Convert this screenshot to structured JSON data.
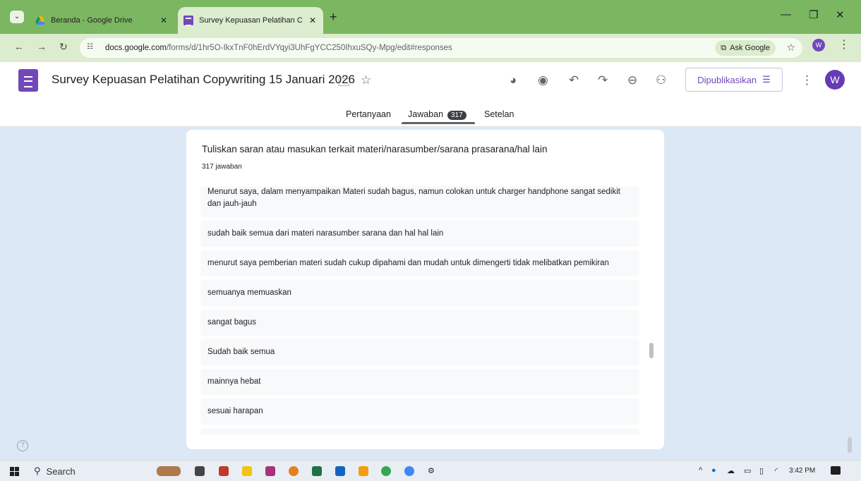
{
  "browser": {
    "tabs": [
      {
        "title": "Beranda - Google Drive",
        "active": false
      },
      {
        "title": "Survey Kepuasan Pelatihan Cop",
        "active": true
      }
    ],
    "address": {
      "host": "docs.google.com",
      "path": "/forms/d/1hr5O-IkxTnF0hErdVYqyi3UhFgYCC250IhxuSQy-Mpg/edit#responses"
    },
    "ask_google_label": "Ask Google",
    "profile_letter": "W"
  },
  "form": {
    "title": "Survey Kepuasan Pelatihan Copywriting 15 Januari 2026",
    "publish_label": "Dipublikasikan",
    "avatar_letter": "W",
    "tabs": [
      {
        "label": "Pertanyaan"
      },
      {
        "label": "Jawaban",
        "count": "317"
      },
      {
        "label": "Setelan"
      }
    ]
  },
  "question": {
    "title": "Tuliskan saran atau masukan terkait materi/narasumber/sarana prasarana/hal lain",
    "count_label": "317 jawaban",
    "answers": [
      "Menurut saya, dalam menyampaikan Materi sudah bagus, namun colokan untuk charger handphone sangat sedikit dan jauh-jauh",
      "sudah baik semua dari materi narasumber sarana dan hal hal lain",
      "menurut saya pemberian materi sudah cukup dipahami dan mudah untuk dimengerti tidak melibatkan pemikiran",
      "semuanya memuaskan",
      "sangat bagus",
      "Sudah baik semua",
      "mainnya hebat",
      "sesuai harapan",
      "---"
    ]
  },
  "taskbar": {
    "search_label": "Search",
    "time": "3:42 PM"
  },
  "colors": {
    "tabstrip": "#7bb661",
    "forms_accent": "#7248b9",
    "page_bg": "#dce8f5"
  }
}
